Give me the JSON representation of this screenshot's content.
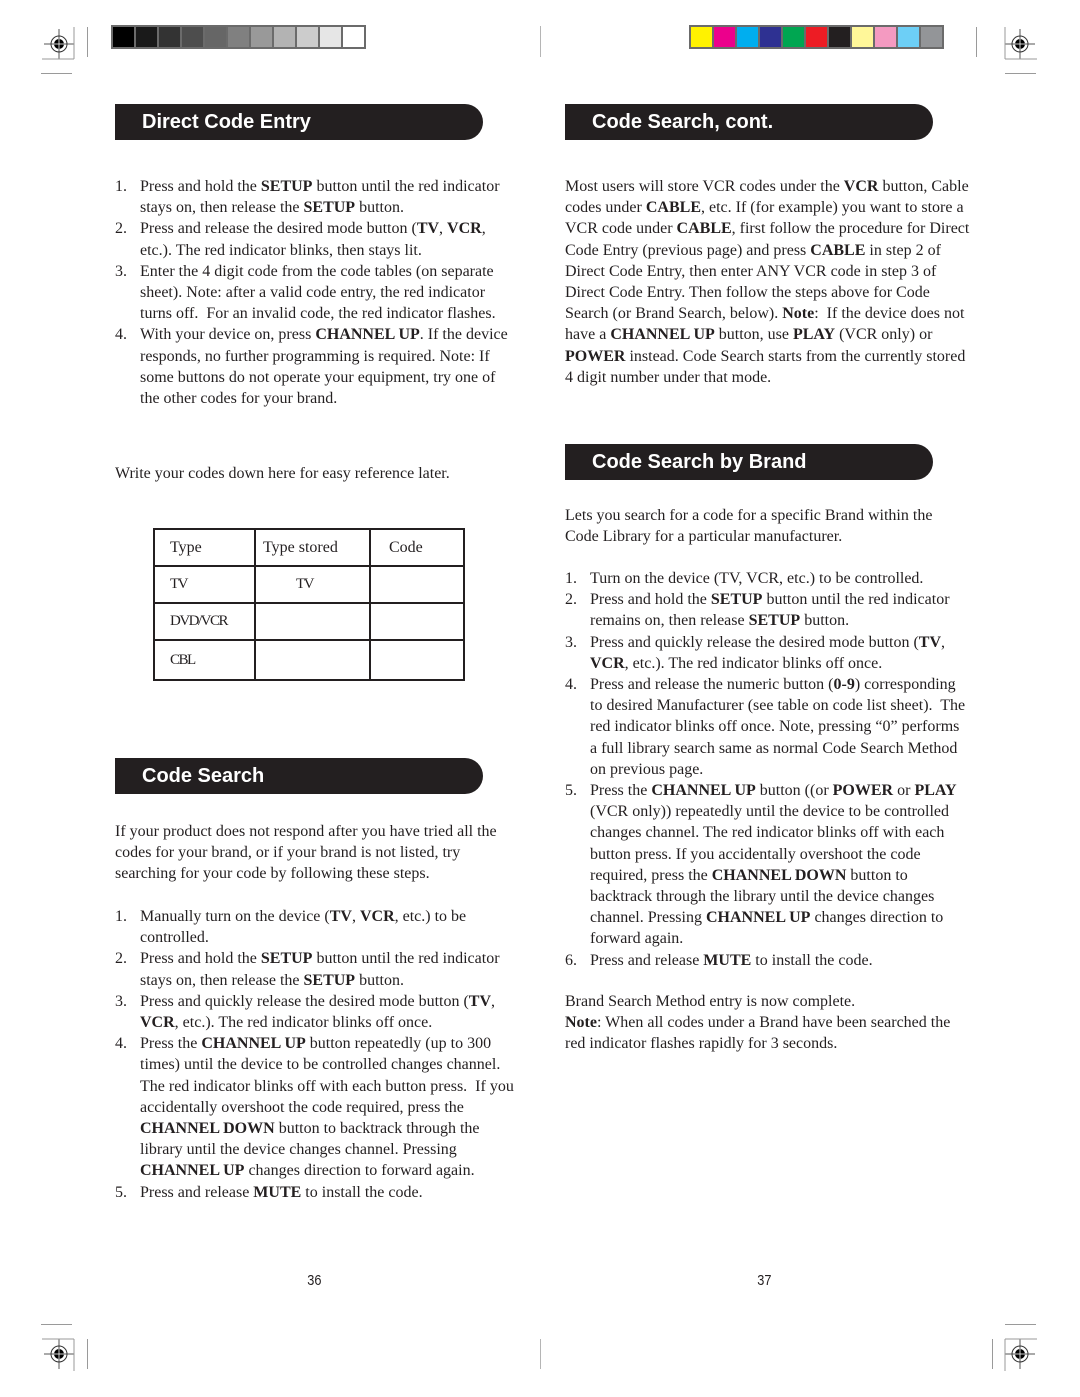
{
  "print_marks": {
    "grayscale_swatches": [
      "#000000",
      "#1a1a1a",
      "#333333",
      "#4d4d4d",
      "#666666",
      "#808080",
      "#999999",
      "#b3b3b3",
      "#cccccc",
      "#e6e6e6",
      "#ffffff"
    ],
    "color_swatches": [
      "#fff200",
      "#ec008c",
      "#00aeef",
      "#2e3192",
      "#00a651",
      "#ed1c24",
      "#231f20",
      "#fff799",
      "#f49ac1",
      "#6dcff6",
      "#939598"
    ],
    "registration_icon": "crosshair-target-icon"
  },
  "left_page": {
    "direct_code_entry": {
      "title": "Direct Code Entry",
      "steps": [
        {
          "num": "1.",
          "html": "Press and hold the <b>SETUP</b> button until the red indicator stays on, then release the <b>SETUP</b> button."
        },
        {
          "num": "2.",
          "html": "Press and release the desired mode button (<b>TV</b>, <b>VCR</b>, etc.). The red indicator blinks, then stays lit."
        },
        {
          "num": "3.",
          "html": "Enter the 4 digit code from the code tables (on separate sheet). Note: after a valid code entry, the red indicator turns off.&nbsp; For an invalid code, the red indicator flashes."
        },
        {
          "num": "4.",
          "html": "With your device on, press <b>CHANNEL UP</b>. If the device responds, no further programming is required. Note: If some buttons do not operate your equipment, try one of the other codes for your brand."
        }
      ],
      "reference_note": "Write your codes down here for easy reference later.",
      "table": {
        "headers": [
          "Type",
          "Type  stored",
          "Code"
        ],
        "rows": [
          [
            "TV",
            "TV",
            ""
          ],
          [
            "DVD/VCR",
            "",
            ""
          ],
          [
            "CBL",
            "",
            ""
          ]
        ]
      }
    },
    "code_search": {
      "title": "Code Search",
      "intro": "If your product does not respond after you have tried all the codes for your brand, or if your brand is not listed, try searching for your code by following these steps.",
      "steps": [
        {
          "num": "1.",
          "html": "Manually turn on the device (<b>TV</b>, <b>VCR</b>, etc.) to be controlled."
        },
        {
          "num": "2.",
          "html": "Press and hold the <b>SETUP</b> button until the red indicator stays on, then release the <b>SETUP</b> button."
        },
        {
          "num": "3.",
          "html": "Press and quickly release the desired mode button (<b>TV</b>, <b>VCR</b>, etc.). The red indicator blinks off once."
        },
        {
          "num": "4.",
          "html": "Press the <b>CHANNEL UP</b> button repeatedly (up to 300 times) until the device to be controlled changes channel. The red indicator blinks off with each button press.&nbsp; If you accidentally overshoot the code required, press the <b>CHANNEL DOWN</b> button to backtrack through the library until the device changes channel. Pressing <b>CHANNEL UP</b> changes direction to forward again."
        },
        {
          "num": "5.",
          "html": "Press and release <b>MUTE</b> to install the code."
        }
      ]
    },
    "page_number": "36"
  },
  "right_page": {
    "code_search_cont": {
      "title": "Code Search, cont.",
      "body_html": "Most users will store VCR codes under the <b>VCR</b> button, Cable codes under <b>CABLE</b>, etc. If (for example) you want to store a VCR code under <b>CABLE</b>, first follow the procedure for Direct Code Entry (previous page) and press <b>CABLE</b> in step 2 of Direct Code Entry, then enter ANY VCR code in step 3 of Direct Code Entry. Then follow the steps above for Code Search (or Brand Search, below). <b>Note</b>:&nbsp; If the device does not have a <b>CHANNEL UP</b> button, use <b>PLAY</b> (VCR only) or <b>POWER</b> instead. Code Search starts from the currently stored 4 digit number under that mode."
    },
    "code_search_by_brand": {
      "title": "Code Search by Brand",
      "intro": "Lets you search for a code for a specific Brand within the Code Library for a particular manufacturer.",
      "steps": [
        {
          "num": "1.",
          "html": "Turn on the device (TV, VCR, etc.) to be controlled."
        },
        {
          "num": "2.",
          "html": "Press and hold the <b>SETUP</b> button until the red indicator remains on, then release <b>SETUP</b> button."
        },
        {
          "num": "3.",
          "html": "Press and quickly release the desired mode button (<b>TV</b>, <b>VCR</b>, etc.). The red indicator blinks off once."
        },
        {
          "num": "4.",
          "html": "Press and release the numeric button (<b>0-9</b>) corresponding to desired Manufacturer (see table on code list sheet).&nbsp; The red indicator blinks off once. Note, pressing “0” performs a full library search same as normal Code Search Method on previous page."
        },
        {
          "num": "5.",
          "html": "Press the <b>CHANNEL UP</b> button ((or <b>POWER</b> or <b>PLAY</b> (VCR only)) repeatedly until the device to be controlled changes channel. The red indicator blinks off with each button press. If you accidentally overshoot the code required, press the <b>CHANNEL DOWN</b> button to backtrack through the library until the device changes channel. Pressing <b>CHANNEL UP</b> changes direction to forward again."
        },
        {
          "num": "6.",
          "html": "Press and release <b>MUTE</b> to install the code."
        }
      ],
      "completion": "Brand Search Method entry is now complete.",
      "note_label": "Note",
      "note_text": ": When all codes under a Brand have been searched the red indicator flashes rapidly for 3 seconds."
    },
    "page_number": "37"
  }
}
